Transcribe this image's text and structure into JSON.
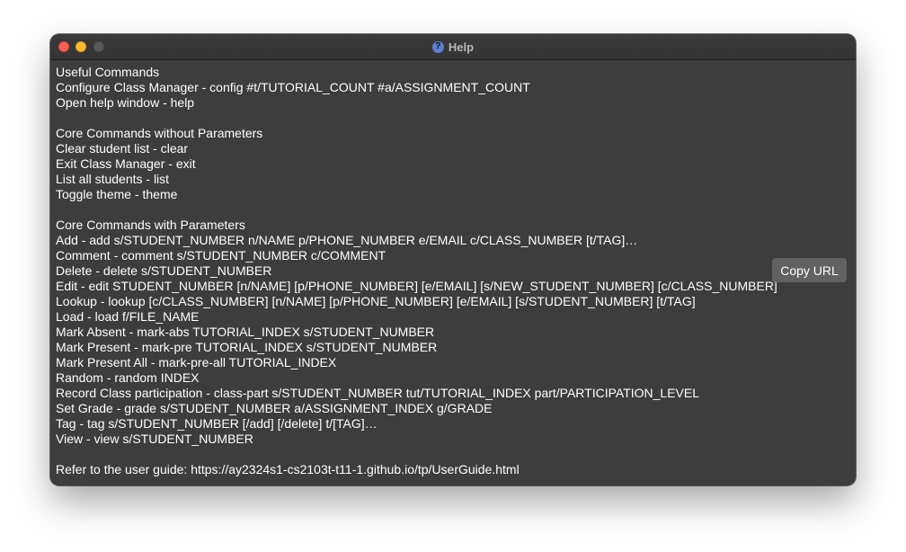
{
  "window": {
    "title": "Help"
  },
  "sections": [
    {
      "lines": [
        "Useful Commands",
        "Configure Class Manager - config #t/TUTORIAL_COUNT #a/ASSIGNMENT_COUNT",
        "Open help window - help"
      ]
    },
    {
      "lines": [
        "Core Commands without Parameters",
        "Clear student list - clear",
        "Exit Class Manager - exit",
        "List all students - list",
        "Toggle theme - theme"
      ]
    },
    {
      "lines": [
        "Core Commands with Parameters",
        "Add - add s/STUDENT_NUMBER n/NAME p/PHONE_NUMBER e/EMAIL c/CLASS_NUMBER [t/TAG]…",
        "Comment - comment s/STUDENT_NUMBER c/COMMENT",
        "Delete - delete s/STUDENT_NUMBER",
        "Edit - edit STUDENT_NUMBER [n/NAME] [p/PHONE_NUMBER] [e/EMAIL] [s/NEW_STUDENT_NUMBER] [c/CLASS_NUMBER]",
        "Lookup - lookup [c/CLASS_NUMBER] [n/NAME] [p/PHONE_NUMBER] [e/EMAIL] [s/STUDENT_NUMBER] [t/TAG]",
        "Load - load f/FILE_NAME",
        "Mark Absent - mark-abs TUTORIAL_INDEX s/STUDENT_NUMBER",
        "Mark Present - mark-pre TUTORIAL_INDEX s/STUDENT_NUMBER",
        "Mark Present All - mark-pre-all TUTORIAL_INDEX",
        "Random - random INDEX",
        "Record Class participation - class-part s/STUDENT_NUMBER tut/TUTORIAL_INDEX part/PARTICIPATION_LEVEL",
        "Set Grade - grade s/STUDENT_NUMBER a/ASSIGNMENT_INDEX g/GRADE",
        "Tag - tag s/STUDENT_NUMBER [/add] [/delete] t/[TAG]…",
        "View - view s/STUDENT_NUMBER"
      ]
    },
    {
      "lines": [
        "Refer to the user guide: https://ay2324s1-cs2103t-t11-1.github.io/tp/UserGuide.html"
      ]
    }
  ],
  "copy_button": {
    "label": "Copy URL"
  },
  "colors": {
    "background": "#3d3d3d",
    "text": "#ffffff",
    "button": "#626262",
    "close": "#ff5f57",
    "minimize": "#febc2e",
    "zoom": "#5a5a5a"
  }
}
